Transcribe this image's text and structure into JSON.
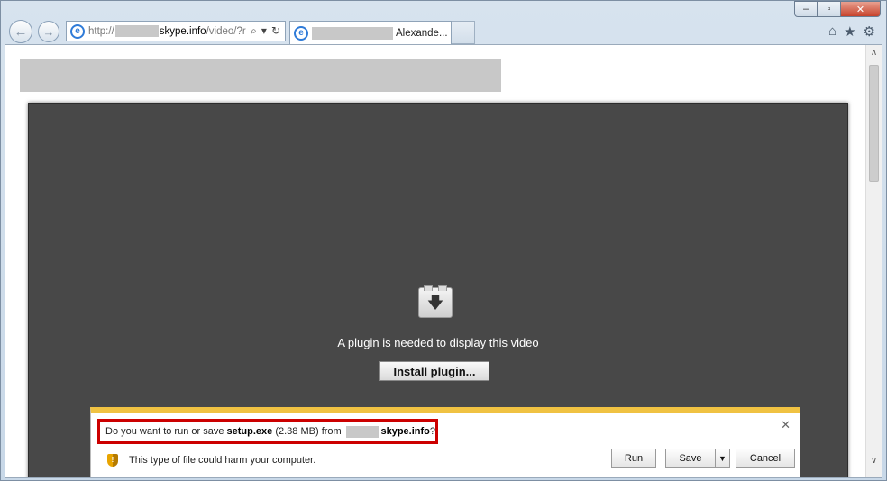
{
  "browser": {
    "address": {
      "scheme": "http://",
      "domain": "skype.info",
      "path": "/video/?r",
      "search_icon": "⌕",
      "dropdown_icon": "▾",
      "refresh_icon": "↻"
    },
    "tab": {
      "title": "Alexande..."
    },
    "window_controls": {
      "minimize": "‒",
      "maximize": "▫",
      "close": "✕"
    },
    "commands": {
      "home_icon": "⌂",
      "favorites_icon": "★",
      "tools_icon": "⚙"
    },
    "nav": {
      "back_icon": "←",
      "forward_icon": "→"
    }
  },
  "player": {
    "message": "A plugin is needed to display this video",
    "install_label": "Install plugin...",
    "plugin_icon": "🡇"
  },
  "notification": {
    "question_prefix": "Do you want to run or save ",
    "file_name": "setup.exe",
    "file_size": " (2.38 MB) from ",
    "domain": "skype.info",
    "question_suffix": "?",
    "warning": "This type of file could harm your computer.",
    "run_label": "Run",
    "save_label": "Save",
    "cancel_label": "Cancel",
    "close_icon": "✕",
    "save_drop_icon": "▼"
  },
  "scrollbar": {
    "up_icon": "∧",
    "down_icon": "∨"
  }
}
